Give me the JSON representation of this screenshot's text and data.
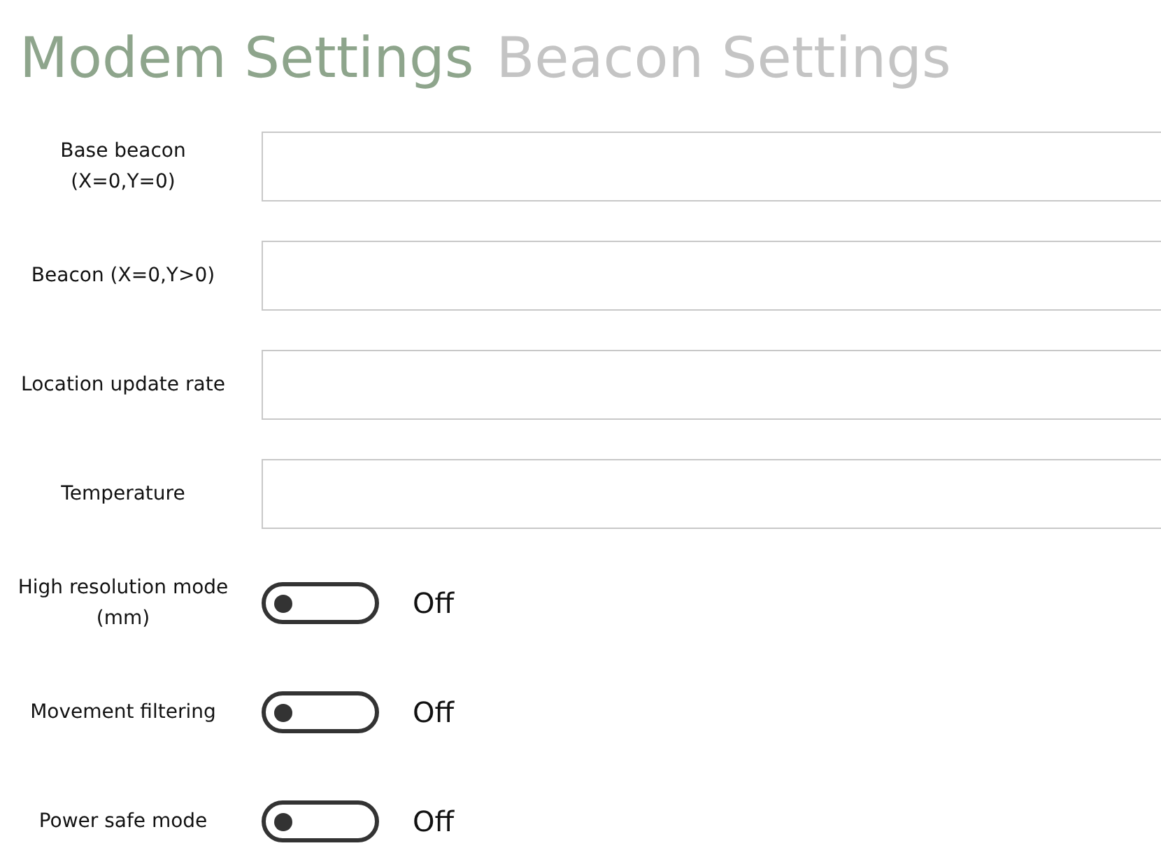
{
  "tabs": [
    {
      "label": "Modem Settings",
      "selected": true
    },
    {
      "label": "Beacon Settings",
      "selected": false
    }
  ],
  "fields": [
    {
      "label": "Base beacon (X=0,Y=0)"
    },
    {
      "label": "Beacon (X=0,Y>0)"
    },
    {
      "label": "Location update rate"
    },
    {
      "label": "Temperature"
    }
  ],
  "toggles": [
    {
      "label": "High resolution mode (mm)",
      "on": false,
      "state_text": "Off"
    },
    {
      "label": "Movement filtering",
      "on": false,
      "state_text": "Off"
    },
    {
      "label": "Power safe mode",
      "on": false,
      "state_text": "Off"
    }
  ]
}
